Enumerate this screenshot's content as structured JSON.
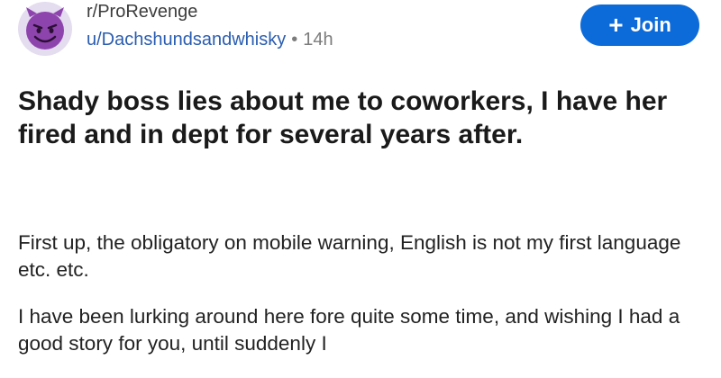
{
  "post": {
    "subreddit": "r/ProRevenge",
    "username": "u/Dachshundsandwhisky",
    "separator": "•",
    "time": "14h",
    "avatar_icon": "devil-face-icon",
    "join_label": "Join",
    "join_icon": "plus-icon",
    "title": "Shady boss lies about me to coworkers, I have her fired and in dept for several years after.",
    "paragraphs": [
      "First up, the obligatory on mobile warning, English is not my first language etc. etc.",
      "I have been lurking around here fore quite some time, and wishing I had a good story for you, until suddenly I"
    ]
  },
  "colors": {
    "join_button": "#0d6bd9",
    "username": "#2a5db0",
    "avatar_bg": "#e4dcef",
    "avatar_face": "#8e44ad"
  }
}
